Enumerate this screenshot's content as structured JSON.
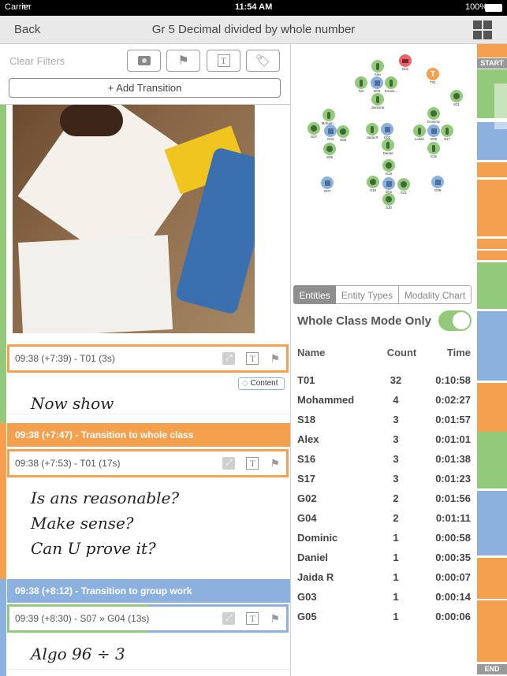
{
  "status_bar": {
    "carrier": "Carrier",
    "time": "11:54 AM",
    "battery": "100%"
  },
  "nav": {
    "back": "Back",
    "title": "Gr 5 Decimal divided by whole number",
    "menu_icon": "grid-icon"
  },
  "filters": {
    "clear": "Clear Filters",
    "buttons": [
      "camera-icon",
      "flag-icon",
      "text-icon",
      "tag-icon"
    ],
    "add_transition": "+ Add Transition"
  },
  "feed": {
    "events": [
      {
        "label": "09:38 (+7:39) - T01 (3s)",
        "tag": "Content",
        "note": "Now show"
      },
      {
        "label": "09:38 (+7:53) - T01 (17s)",
        "note_lines": [
          "Is ans reasonable?",
          "Make sense?",
          "Can U prove it?"
        ]
      },
      {
        "label": "09:39 (+8:30) - S07 » G04 (13s)",
        "note": "Algo 96 ÷ 3"
      }
    ],
    "transitions": [
      {
        "label": "09:38 (+7:47) - Transition to whole class",
        "color": "#f5a04f"
      },
      {
        "label": "09:38 (+8:12) - Transition to group work",
        "color": "#8db1de"
      }
    ]
  },
  "colors": {
    "green": "#93c97b",
    "orange": "#f5a04f",
    "blue": "#8db1de",
    "red": "#e8636a",
    "node_dark": "#3e6b35",
    "group_dark": "#4e6f9a"
  },
  "network": {
    "nodes": [
      {
        "label": "D01",
        "type": "device"
      },
      {
        "label": "T01",
        "type": "teacher"
      },
      {
        "label": "Alex",
        "type": "person"
      },
      {
        "label": "Tori",
        "type": "person"
      },
      {
        "label": "G03",
        "type": "group"
      },
      {
        "label": "Kouss...",
        "type": "person"
      },
      {
        "label": "Jasmine",
        "type": "person"
      },
      {
        "label": "S01",
        "type": "student"
      },
      {
        "label": "Moham...",
        "type": "person"
      },
      {
        "label": "S07",
        "type": "student"
      },
      {
        "label": "G04",
        "type": "group"
      },
      {
        "label": "S08",
        "type": "student"
      },
      {
        "label": "S09",
        "type": "student"
      },
      {
        "label": "Jaida R",
        "type": "person"
      },
      {
        "label": "G02",
        "type": "group"
      },
      {
        "label": "Daniel",
        "type": "person"
      },
      {
        "label": "Dominic",
        "type": "student"
      },
      {
        "label": "Leilah",
        "type": "person"
      },
      {
        "label": "G05",
        "type": "group"
      },
      {
        "label": "S17",
        "type": "person"
      },
      {
        "label": "S16",
        "type": "person"
      },
      {
        "label": "S18",
        "type": "student"
      },
      {
        "label": "G07",
        "type": "group"
      },
      {
        "label": "S19",
        "type": "student"
      },
      {
        "label": "G01",
        "type": "group"
      },
      {
        "label": "S21",
        "type": "student"
      },
      {
        "label": "G08",
        "type": "group"
      },
      {
        "label": "S20",
        "type": "student"
      }
    ]
  },
  "panel": {
    "tabs": [
      "Entities",
      "Entity Types",
      "Modality Chart"
    ],
    "active_tab": 0,
    "toggle_label": "Whole Class Mode Only",
    "toggle_on": true,
    "columns": [
      "Name",
      "Count",
      "Time"
    ],
    "rows": [
      [
        "T01",
        "32",
        "0:10:58"
      ],
      [
        "Mohammed",
        "4",
        "0:02:27"
      ],
      [
        "S18",
        "3",
        "0:01:57"
      ],
      [
        "Alex",
        "3",
        "0:01:01"
      ],
      [
        "S16",
        "3",
        "0:01:38"
      ],
      [
        "S17",
        "3",
        "0:01:23"
      ],
      [
        "G02",
        "2",
        "0:01:56"
      ],
      [
        "G04",
        "2",
        "0:01:11"
      ],
      [
        "Dominic",
        "1",
        "0:00:58"
      ],
      [
        "Daniel",
        "1",
        "0:00:35"
      ],
      [
        "Jaida R",
        "1",
        "0:00:07"
      ],
      [
        "G03",
        "1",
        "0:00:14"
      ],
      [
        "G05",
        "1",
        "0:00:06"
      ]
    ]
  },
  "timeline": {
    "start": "START",
    "end": "END",
    "segments": [
      "orange",
      "green",
      "blue",
      "orange",
      "orange",
      "orange",
      "orange",
      "green",
      "blue",
      "orange",
      "orange",
      "green",
      "blue",
      "orange",
      "orange",
      "orange"
    ]
  }
}
